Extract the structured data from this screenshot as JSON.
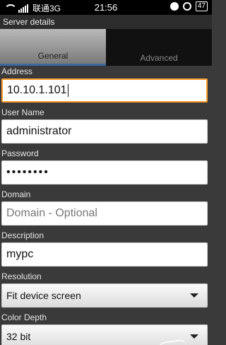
{
  "status": {
    "carrier": "联通3G",
    "time": "21:56",
    "battery": "47"
  },
  "titlebar": {
    "title": "Server details"
  },
  "tabs": [
    {
      "label": "General",
      "active": true
    },
    {
      "label": "Advanced",
      "active": false
    }
  ],
  "form": {
    "address": {
      "label": "Address",
      "value": "10.10.1.101"
    },
    "username": {
      "label": "User Name",
      "value": "administrator"
    },
    "password": {
      "label": "Password",
      "value": "••••••••"
    },
    "domain": {
      "label": "Domain",
      "placeholder": "Domain - Optional"
    },
    "description": {
      "label": "Description",
      "value": "mypc"
    },
    "resolution": {
      "label": "Resolution",
      "value": "Fit device screen"
    },
    "color_depth": {
      "label": "Color Depth",
      "value": "32 bit"
    }
  },
  "icons": [
    "wifi-icon",
    "signal-icon",
    "ghost-icon",
    "alarm-clock-icon",
    "battery-icon",
    "chevron-down-icon"
  ],
  "colors": {
    "focus_border": "#ff9d2f",
    "tab_underline": "#3b6aa0"
  }
}
